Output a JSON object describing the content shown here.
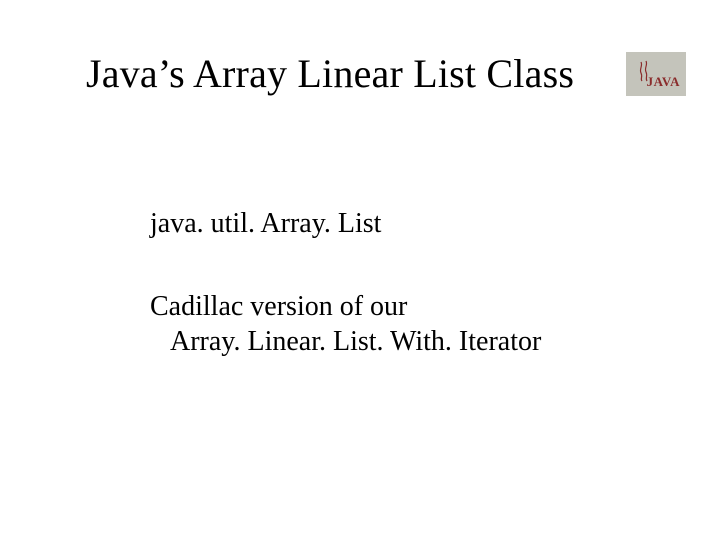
{
  "title": "Java’s Array Linear List Class",
  "logo": {
    "text": "JAVA"
  },
  "content": {
    "line1": "java. util. Array. List",
    "line2": "Cadillac version of our",
    "line3": "Array. Linear. List. With. Iterator"
  }
}
